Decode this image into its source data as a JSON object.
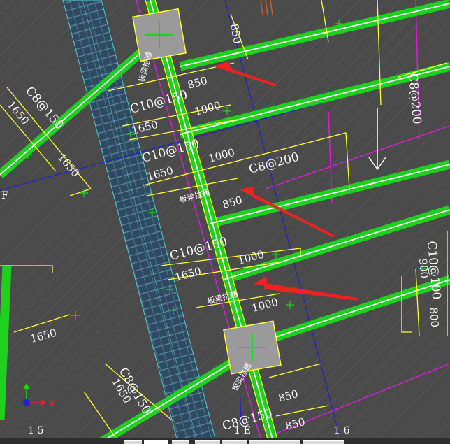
{
  "colors": {
    "background": "#4a4a4a",
    "beam_green": "#1fd11f",
    "beam_center": "#ffffff",
    "dimension_yellow": "#ffff33",
    "axis_blue": "#2222cc",
    "magenta": "#e21be2",
    "wall_hatch": "#2f4a60",
    "column_fill": "#9a9a9a",
    "arrow_red": "#ee2222"
  },
  "column_tags": [
    "板梁拉通",
    "板梁拉通",
    "板梁拉通",
    "板梁拉通"
  ],
  "reinforcement_labels": [
    "C8@150",
    "C10@150",
    "C10@150",
    "C8@200",
    "C8@200",
    "C10@100",
    "C10@150",
    "C8@150",
    "C8@150"
  ],
  "dimensions": [
    "1650",
    "1650",
    "850",
    "1000",
    "1650",
    "1000",
    "1650",
    "850",
    "1000",
    "1650",
    "1000",
    "1650",
    "1650",
    "850",
    "850",
    "850",
    "900",
    "800"
  ],
  "axis_labels": [
    "F",
    "1-5",
    "1-E",
    "1-6"
  ],
  "ucs": {
    "x_label": "X"
  }
}
